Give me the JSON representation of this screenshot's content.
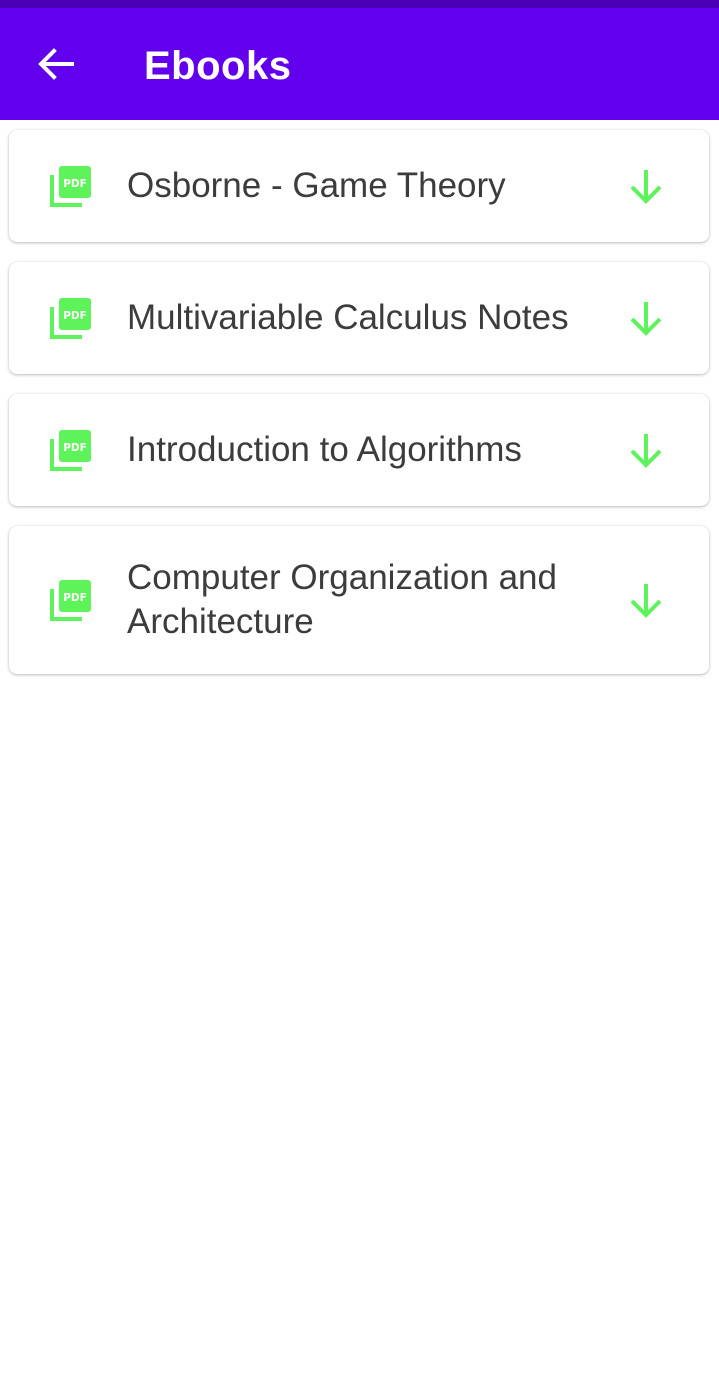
{
  "app_bar": {
    "title": "Ebooks",
    "back_icon": "arrow-left-icon",
    "color": "#6200ee",
    "status_color": "#4a00b5"
  },
  "ebooks": [
    {
      "title": "Osborne - Game Theory",
      "file_icon": "pdf-icon",
      "action_icon": "download-arrow-icon"
    },
    {
      "title": "Multivariable Calculus Notes",
      "file_icon": "pdf-icon",
      "action_icon": "download-arrow-icon"
    },
    {
      "title": "Introduction to Algorithms",
      "file_icon": "pdf-icon",
      "action_icon": "download-arrow-icon"
    },
    {
      "title": "Computer Organization and Architecture",
      "file_icon": "pdf-icon",
      "action_icon": "download-arrow-icon"
    }
  ],
  "colors": {
    "accent_green": "#5ef25b",
    "text": "#3c3c3c"
  },
  "pdf_icon_label": "PDF"
}
